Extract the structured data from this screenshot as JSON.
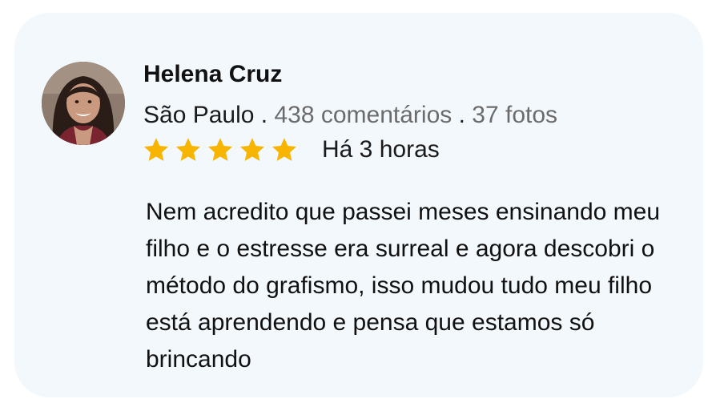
{
  "review": {
    "author_name": "Helena Cruz",
    "location": "São Paulo",
    "separator": " . ",
    "comments_count": "438 comentários",
    "photos_count": "37 fotos",
    "rating": 5,
    "rating_max": 5,
    "star_color": "#f7b500",
    "time_ago": "Há 3 horas",
    "text": "Nem acredito que passei meses ensinando meu filho e o estresse era surreal e agora descobri o método do grafismo, isso mudou tudo meu filho está aprendendo e pensa que estamos só brincando"
  }
}
